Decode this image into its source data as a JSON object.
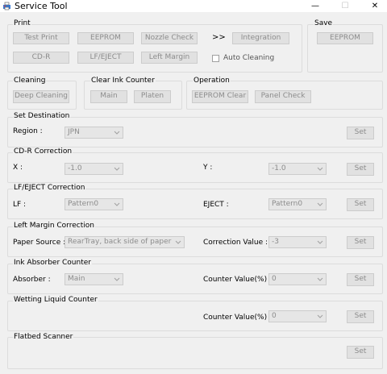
{
  "window": {
    "title": "Service Tool",
    "controls": {
      "minimize": "—",
      "maximize": "☐",
      "close": "✕"
    }
  },
  "print": {
    "label": "Print",
    "buttons": [
      "Test Print",
      "EEPROM",
      "Nozzle Check",
      "CD-R",
      "LF/EJECT",
      "Left Margin"
    ],
    "arrow": ">>",
    "integration": "Integration",
    "auto_cleaning": "Auto Cleaning"
  },
  "save": {
    "label": "Save",
    "eeprom": "EEPROM"
  },
  "cleaning": {
    "label": "Cleaning",
    "deep": "Deep Cleaning"
  },
  "clear_ink": {
    "label": "Clear Ink Counter",
    "main": "Main",
    "platen": "Platen"
  },
  "operation": {
    "label": "Operation",
    "eeprom_clear": "EEPROM Clear",
    "panel_check": "Panel Check"
  },
  "set_destination": {
    "label": "Set Destination",
    "region_label": "Region :",
    "region_value": "JPN",
    "set": "Set"
  },
  "cdr_correction": {
    "label": "CD-R Correction",
    "x_label": "X :",
    "x_value": "-1.0",
    "y_label": "Y :",
    "y_value": "-1.0",
    "set": "Set"
  },
  "lf_eject_correction": {
    "label": "LF/EJECT Correction",
    "lf_label": "LF :",
    "lf_value": "Pattern0",
    "eject_label": "EJECT :",
    "eject_value": "Pattern0",
    "set": "Set"
  },
  "left_margin_correction": {
    "label": "Left Margin Correction",
    "source_label": "Paper Source :",
    "source_value": "RearTray, back side of paper",
    "corr_label": "Correction Value :",
    "corr_value": "-3",
    "set": "Set"
  },
  "ink_absorber": {
    "label": "Ink Absorber Counter",
    "absorber_label": "Absorber :",
    "absorber_value": "Main",
    "counter_label": "Counter Value(%) :",
    "counter_value": "0",
    "set": "Set"
  },
  "wetting_liquid": {
    "label": "Wetting Liquid Counter",
    "counter_label": "Counter Value(%) :",
    "counter_value": "0",
    "set": "Set"
  },
  "flatbed": {
    "label": "Flatbed Scanner",
    "set": "Set"
  }
}
